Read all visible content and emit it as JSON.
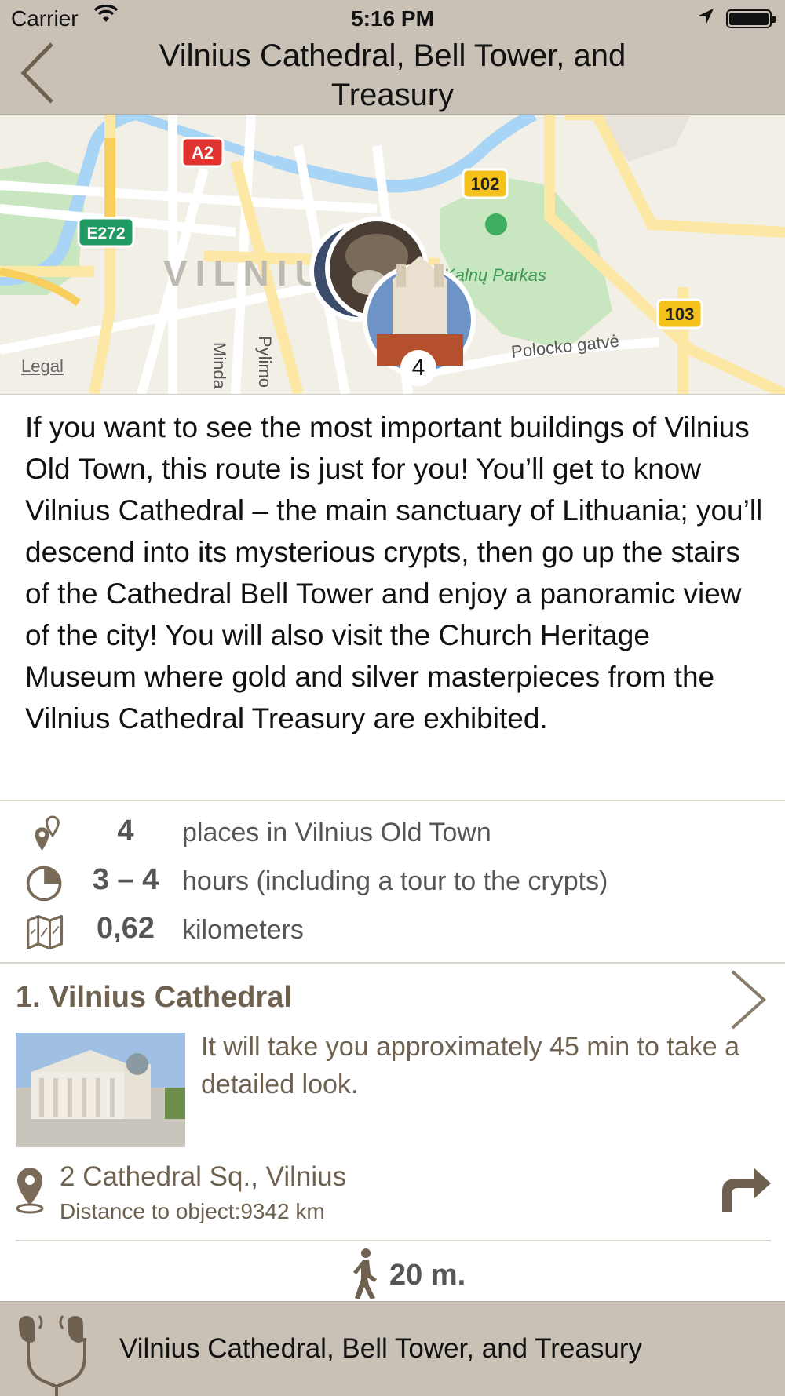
{
  "status_bar": {
    "carrier": "Carrier",
    "time": "5:16 PM"
  },
  "nav": {
    "title": "Vilnius Cathedral, Bell Tower, and Treasury",
    "back_icon": "chevron-left-icon"
  },
  "map": {
    "labels": {
      "a2": "A2",
      "e272": "E272",
      "r102": "102",
      "r103": "103",
      "city": "VILNIUS",
      "park": "Kalnų Parkas",
      "street1": "Polocko gatvė",
      "street2": "Minda",
      "street3": "Pylimo"
    },
    "cluster_count": "4",
    "legal": "Legal",
    "colors": {
      "water": "#a8d4f5",
      "park": "#c8e6c0",
      "road": "#fde7a4",
      "road_yellow": "#f8cf5c"
    }
  },
  "description": "If you want to see the most important buildings of Vilnius Old Town, this route is just for you! You’ll get to know Vilnius Cathedral – the main sanctuary of Lithuania; you’ll descend into its mysterious crypts, then go up the stairs of the Cathedral Bell Tower and enjoy a panoramic view of the city! You will also visit the Church Heritage Museum where gold and silver masterpieces from the Vilnius Cathedral Treasury are exhibited.",
  "stats": [
    {
      "icon": "map-pins-icon",
      "value": "4",
      "label": "places in Vilnius Old Town"
    },
    {
      "icon": "clock-icon",
      "value": "3 – 4",
      "label": "hours (including a tour to the crypts)"
    },
    {
      "icon": "folded-map-icon",
      "value": "0,62",
      "label": "kilometers"
    }
  ],
  "place": {
    "title": "1. Vilnius Cathedral",
    "text": "It will take you approximately 45 min to take a detailed look.",
    "address": "2 Cathedral Sq., Vilnius",
    "distance": "Distance to object:9342 km",
    "walk": "20 m."
  },
  "player": {
    "title": "Vilnius Cathedral, Bell Tower, and Treasury",
    "icon": "headphones-icon"
  },
  "colors": {
    "bar": "#c9c1b5",
    "accent_text": "#6f6150",
    "stat_text": "#555555"
  }
}
